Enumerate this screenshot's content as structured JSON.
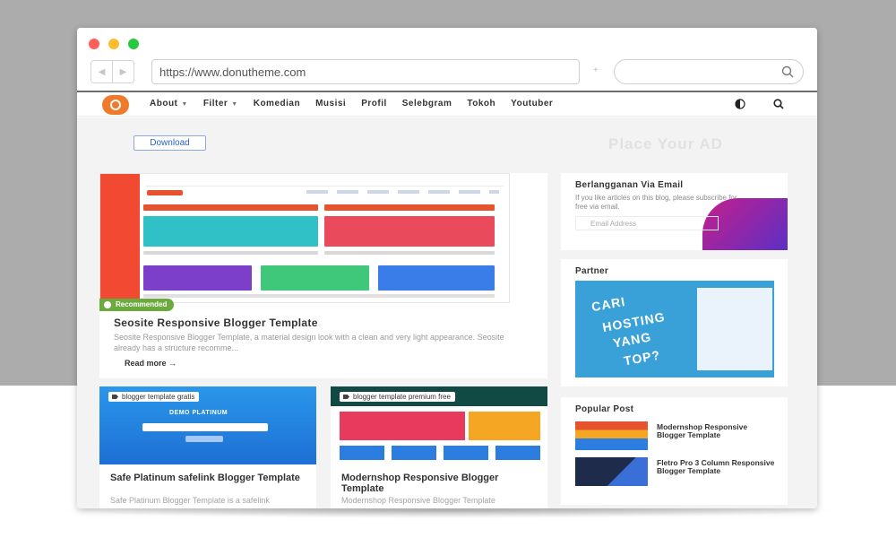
{
  "browser": {
    "url": "https://www.donutheme.com",
    "search_value": ""
  },
  "nav": {
    "items": [
      {
        "label": "About",
        "dropdown": true
      },
      {
        "label": "Filter",
        "dropdown": true
      },
      {
        "label": "Komedian",
        "dropdown": false
      },
      {
        "label": "Musisi",
        "dropdown": false
      },
      {
        "label": "Profil",
        "dropdown": false
      },
      {
        "label": "Selebgram",
        "dropdown": false
      },
      {
        "label": "Tokoh",
        "dropdown": false
      },
      {
        "label": "Youtuber",
        "dropdown": false
      }
    ]
  },
  "page": {
    "download_label": "Download",
    "ad_text": "Place Your AD"
  },
  "featured": {
    "badge": "Recommended",
    "title": "Seosite Responsive Blogger Template",
    "excerpt": "Seosite Responsive Blogger Template, a material design look with a clean and very light appearance. Seosite already has a structure recomme...",
    "read_more": "Read more"
  },
  "posts": [
    {
      "tag": "blogger template gratis",
      "title": "Safe Platinum safelink Blogger Template",
      "excerpt": "Safe Platinum Blogger Template is a safelink",
      "thumb_text": "DEMO PLATINUM"
    },
    {
      "tag": "blogger template premium free",
      "title": "Modernshop Responsive Blogger Template",
      "excerpt": "Modernshop Responsive Blogger Template"
    }
  ],
  "sidebar": {
    "email": {
      "title": "Berlangganan Via Email",
      "text": "If you like articles on this blog, please subscribe for free via email.",
      "placeholder": "Email Address"
    },
    "partner": {
      "title": "Partner",
      "words": [
        "CARI",
        "HOSTING",
        "YANG",
        "TOP?"
      ]
    },
    "popular": {
      "title": "Popular Post",
      "items": [
        {
          "title": "Modernshop Responsive Blogger Template"
        },
        {
          "title": "Fletro Pro 3 Column Responsive Blogger Template"
        }
      ]
    }
  },
  "colors": {
    "backdrop": "#acacac",
    "logo": "#f07a2c",
    "badge": "#6bab3e",
    "link_blue": "#2a63c6",
    "partner_blue": "#3aa0d8"
  }
}
